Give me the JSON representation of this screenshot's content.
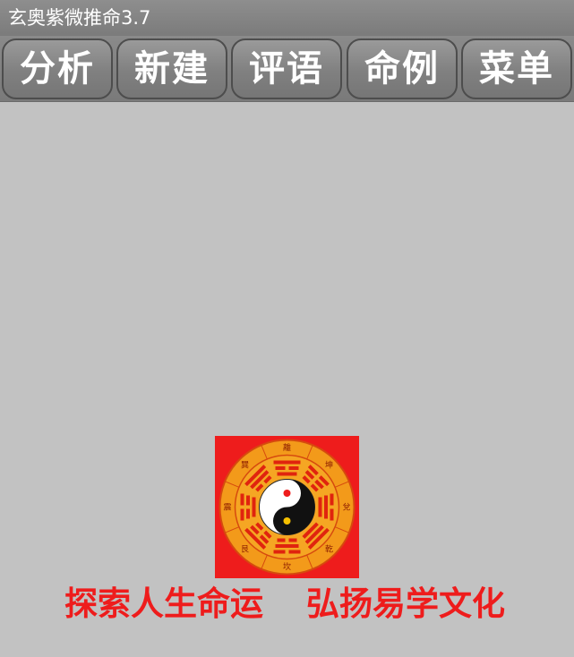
{
  "app": {
    "title": "玄奥紫微推命3.7"
  },
  "toolbar": {
    "buttons": [
      {
        "label": "分析"
      },
      {
        "label": "新建"
      },
      {
        "label": "评语"
      },
      {
        "label": "命例"
      },
      {
        "label": "菜单"
      }
    ]
  },
  "logo": {
    "icon": "bagua-yin-yang-icon",
    "trigrams": [
      "離",
      "坤",
      "兌",
      "乾",
      "坎",
      "艮",
      "震",
      "巽"
    ]
  },
  "slogan": {
    "part1": "探索人生命运",
    "part2": "弘扬易学文化"
  },
  "colors": {
    "background": "#c2c2c2",
    "toolbar": "#808080",
    "slogan": "#ee1c1c",
    "logo_red": "#ee1c1c",
    "logo_orange": "#f39a1a"
  }
}
